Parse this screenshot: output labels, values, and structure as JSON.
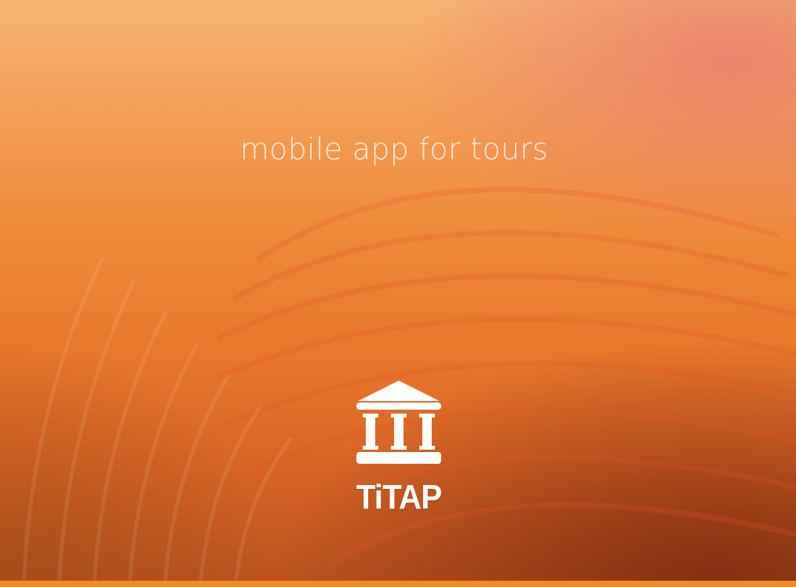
{
  "tagline": "mobile app for tours",
  "brand": {
    "name": "TiTAP",
    "logo_icon": "museum-building-icon"
  },
  "colors": {
    "bottom_bar": "#f28c1f",
    "text": "#ffffff",
    "background_top": "#f7b574",
    "background_bottom": "#b9521f"
  }
}
